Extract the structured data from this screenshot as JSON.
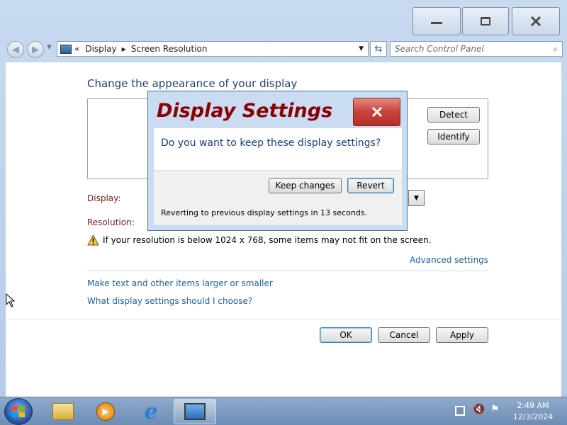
{
  "window": {
    "caption_buttons": {
      "minimize": "minimize",
      "maximize": "maximize",
      "close": "close"
    }
  },
  "address": {
    "crumbs": [
      "«",
      "Display",
      "Screen Resolution"
    ],
    "search_placeholder": "Search Control Panel"
  },
  "main": {
    "title": "Change the appearance of your display",
    "detect_label": "Detect",
    "identify_label": "Identify",
    "display_label": "Display:",
    "resolution_label": "Resolution:",
    "warning_text": "If your resolution is below 1024 x 768, some items may not fit on the screen.",
    "advanced_link": "Advanced settings",
    "links": [
      "Make text and other items larger or smaller",
      "What display settings should I choose?"
    ]
  },
  "footer": {
    "ok": "OK",
    "cancel": "Cancel",
    "apply": "Apply"
  },
  "dialog": {
    "title": "Display Settings",
    "question": "Do you want to keep these display settings?",
    "keep": "Keep changes",
    "revert": "Revert",
    "countdown": "Reverting to previous display settings in 13 seconds."
  },
  "taskbar": {
    "clock_time": "2:49 AM",
    "clock_date": "12/3/2024",
    "icons": [
      "start-orb",
      "explorer-icon",
      "media-player-icon",
      "internet-explorer-icon",
      "display-settings-icon"
    ]
  },
  "colors": {
    "accent": "#1e5fa8",
    "dialog_title": "#8b0000",
    "close_red": "#c8423a"
  }
}
